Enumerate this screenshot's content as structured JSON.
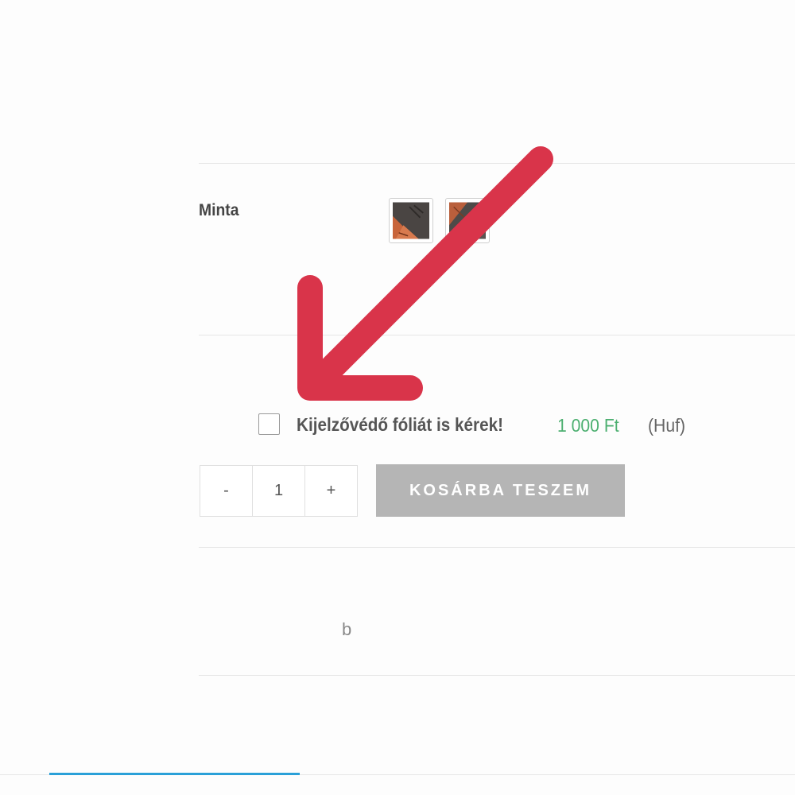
{
  "variation": {
    "label": "Minta",
    "swatches": [
      "wood-pattern-swatch-1",
      "wood-pattern-swatch-2"
    ]
  },
  "addon": {
    "label": "Kijelzővédő fóliát is kérek!",
    "price": "1 000 Ft",
    "currency": "(Huf)",
    "checked": false
  },
  "quantity": {
    "minus": "-",
    "value": "1",
    "plus": "+"
  },
  "cart": {
    "button_label": "KOSÁRBA TESZEM"
  },
  "misc": {
    "stray_text": "b"
  },
  "annotation": {
    "arrow_color": "#d9344a"
  },
  "colors": {
    "price_green": "#4caf70",
    "tab_accent": "#2aa0d8",
    "button_gray": "#b5b5b5"
  }
}
